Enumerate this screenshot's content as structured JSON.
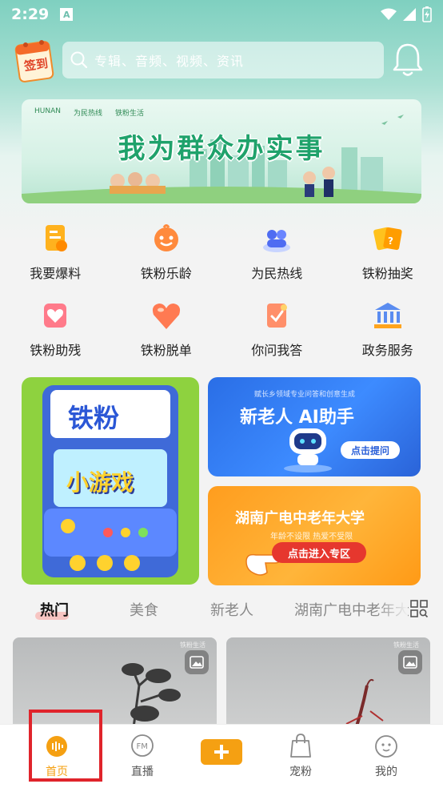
{
  "status_bar": {
    "time": "2:29",
    "notification_letter": "A"
  },
  "header": {
    "checkin_label": "签到",
    "search_placeholder": "专辑、音频、视频、资讯"
  },
  "banner": {
    "logos": [
      "HUNAN",
      "为民热线",
      "铁粉生活"
    ],
    "title": "我为群众办实事"
  },
  "grid_items": [
    {
      "label": "我要爆料",
      "icon": "report-icon"
    },
    {
      "label": "铁粉乐龄",
      "icon": "smile-mascot-icon"
    },
    {
      "label": "为民热线",
      "icon": "hotline-icon"
    },
    {
      "label": "铁粉抽奖",
      "icon": "lottery-icon"
    },
    {
      "label": "铁粉助残",
      "icon": "heart-box-icon"
    },
    {
      "label": "铁粉脱单",
      "icon": "heart-icon"
    },
    {
      "label": "你问我答",
      "icon": "qa-icon"
    },
    {
      "label": "政务服务",
      "icon": "government-building-icon"
    }
  ],
  "promos": {
    "game": {
      "title": "铁粉",
      "subtitle": "小游戏"
    },
    "ai": {
      "small": "赋长乡领域专业问答和创意生成",
      "title": "新老人 AI助手",
      "button": "点击提问"
    },
    "uni": {
      "title": "湖南广电中老年大学",
      "small": "年龄不设限 热爱不受限",
      "button": "点击进入专区"
    }
  },
  "tabs": [
    "热门",
    "美食",
    "新老人",
    "湖南广电中老年大"
  ],
  "feed": {
    "tag": "铁粉生活"
  },
  "bottom_nav": [
    {
      "label": "首页",
      "icon": "home-headphone-icon",
      "active": true
    },
    {
      "label": "直播",
      "icon": "fm-radio-icon",
      "active": false
    },
    {
      "label": "",
      "icon": "plus-icon",
      "active": false
    },
    {
      "label": "宠粉",
      "icon": "shopping-bag-icon",
      "active": false
    },
    {
      "label": "我的",
      "icon": "profile-face-icon",
      "active": false
    }
  ],
  "colors": {
    "accent": "#f5a012",
    "highlight": "#e0242b",
    "teal": "#7fd0c0"
  }
}
